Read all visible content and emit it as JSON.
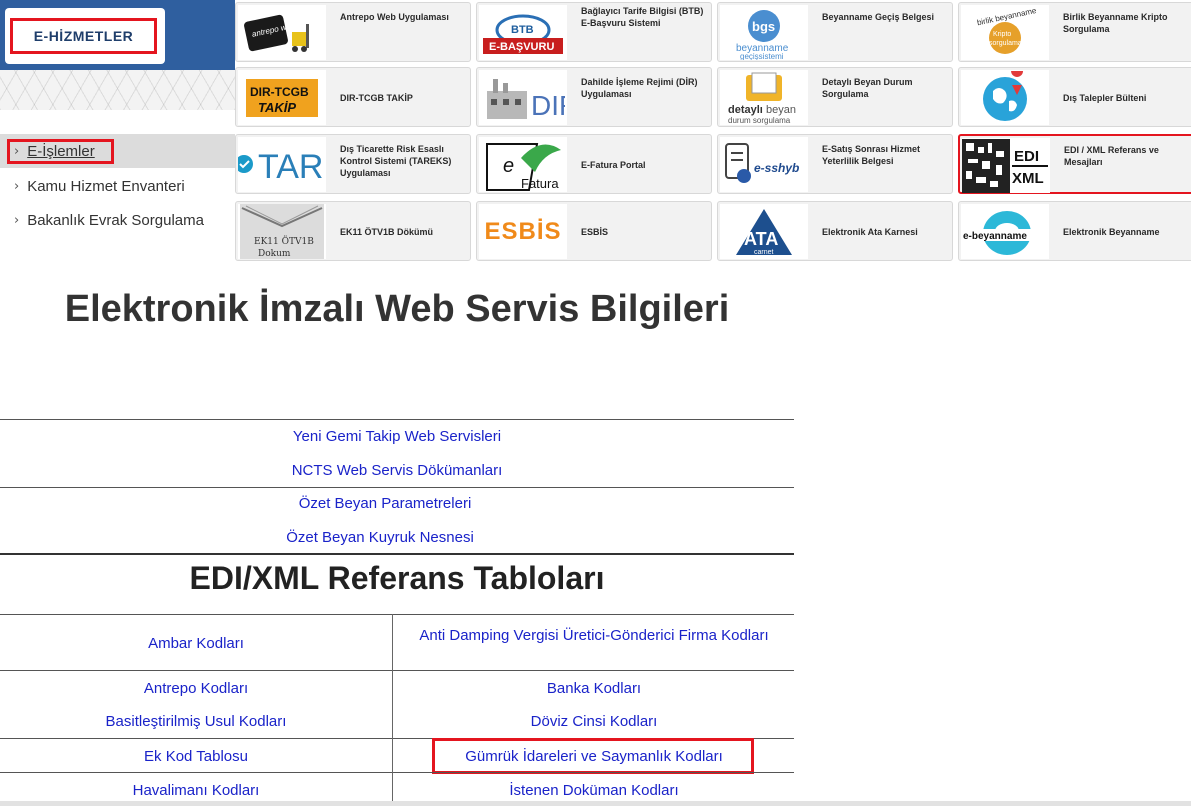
{
  "header": {
    "brand_button": "E-HİZMETLER"
  },
  "sidebar": {
    "items": [
      {
        "label": "E-İşlemler"
      },
      {
        "label": "Kamu Hizmet Envanteri"
      },
      {
        "label": "Bakanlık Evrak Sorgulama"
      }
    ]
  },
  "tiles": [
    {
      "label": "Antrepo Web Uygulaması",
      "icon": "antrepo-web-logo",
      "logo_text": "antrepo web"
    },
    {
      "label": "Bağlayıcı Tarife Bilgisi (BTB) E-Başvuru Sistemi",
      "icon": "btb-logo",
      "logo_text": "BTB E-BAŞVURU"
    },
    {
      "label": "Beyanname Geçiş Belgesi",
      "icon": "bgs-logo",
      "logo_text": "bgs beyanname geçişsistemi"
    },
    {
      "label": "Birlik Beyanname Kripto Sorgulama",
      "icon": "birlik-beyanname-logo",
      "logo_text": "birlik beyanname kripto sorgulama"
    },
    {
      "label": "DIR-TCGB TAKİP",
      "icon": "dir-tcgb-logo",
      "logo_text": "DIR-TCGB TAKİP"
    },
    {
      "label": "Dahilde İşleme Rejimi (DİR) Uygulaması",
      "icon": "dir-factory-logo",
      "logo_text": "DIR"
    },
    {
      "label": "Detaylı Beyan Durum Sorgulama",
      "icon": "detayli-beyan-logo",
      "logo_text": "detaylıbeyan durumsorgulama"
    },
    {
      "label": "Dış Talepler Bülteni",
      "icon": "world-map-pin-logo",
      "logo_text": ""
    },
    {
      "label": "Dış Ticarette Risk Esaslı Kontrol Sistemi (TAREKS) Uygulaması",
      "icon": "tareks-logo",
      "logo_text": "TARE"
    },
    {
      "label": "E-Fatura Portal",
      "icon": "efatura-logo",
      "logo_text": "e Fatura"
    },
    {
      "label": "E-Satış Sonrası Hizmet Yeterlilik Belgesi",
      "icon": "essyb-logo",
      "logo_text": "e-sshyb"
    },
    {
      "label": "EDI / XML Referans ve Mesajları",
      "icon": "edi-xml-logo",
      "logo_text": "EDI XML"
    },
    {
      "label": "EK11 ÖTV1B Dökümü",
      "icon": "ek11-logo",
      "logo_text": "EK11 ÖTV1B Dokum"
    },
    {
      "label": "ESBİS",
      "icon": "esbis-logo",
      "logo_text": "ESBİS"
    },
    {
      "label": "Elektronik Ata Karnesi",
      "icon": "ata-carnet-logo",
      "logo_text": "ATA carnet"
    },
    {
      "label": "Elektronik Beyanname",
      "icon": "e-beyanname-logo",
      "logo_text": "e-beyanname"
    }
  ],
  "main": {
    "title": "Elektronik İmzalı Web Servis Bilgileri",
    "web_service_links": [
      "Yeni Gemi Takip Web Servisleri",
      "NCTS Web Servis Dökümanları",
      "Özet Beyan Parametreleri",
      "Özet Beyan Kuyruk Nesnesi"
    ],
    "edi_title": "EDI/XML Referans Tabloları",
    "edi_table": [
      [
        "Ambar Kodları",
        "Anti Damping Vergisi Üretici-Gönderici Firma Kodları"
      ],
      [
        "Antrepo Kodları",
        "Banka Kodları"
      ],
      [
        "Basitleştirilmiş Usul Kodları",
        "Döviz Cinsi Kodları"
      ],
      [
        "Ek Kod Tablosu",
        "Gümrük İdareleri ve Saymanlık Kodları"
      ],
      [
        "Havalimanı Kodları",
        "İstenen Doküman Kodları"
      ]
    ]
  },
  "colors": {
    "highlight": "#e4151f",
    "link": "#1a23c9",
    "brand": "#2f5f9f"
  }
}
